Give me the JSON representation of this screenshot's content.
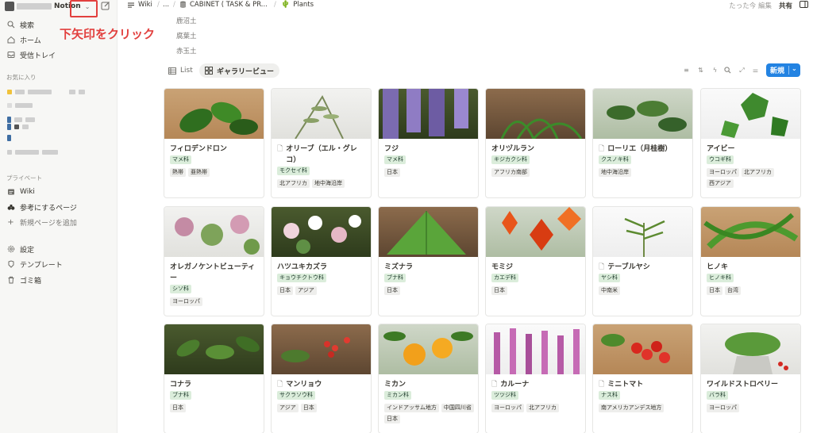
{
  "workspace": {
    "name": "Notion"
  },
  "annotation": "下矢印をクリック",
  "sidebar": {
    "nav": [
      {
        "label": "検索"
      },
      {
        "label": "ホーム"
      },
      {
        "label": "受信トレイ"
      }
    ],
    "favorites_label": "お気に入り",
    "private_label": "プライベート",
    "private_items": [
      {
        "label": "Wiki"
      },
      {
        "label": "参考にするページ"
      },
      {
        "label": "新規ページを追加"
      }
    ],
    "bottom_items": [
      {
        "label": "設定"
      },
      {
        "label": "テンプレート"
      },
      {
        "label": "ゴミ箱"
      }
    ]
  },
  "breadcrumbs": [
    {
      "label": "Wiki"
    },
    {
      "label": "..."
    },
    {
      "label": "CABINET ( TASK & PR..."
    },
    {
      "label": "Plants"
    }
  ],
  "topbar": {
    "edited": "たった今 編集",
    "share": "共有"
  },
  "soil_items": [
    "鹿沼土",
    "腐葉土",
    "赤玉土"
  ],
  "views": [
    {
      "label": "List"
    },
    {
      "label": "ギャラリービュー"
    }
  ],
  "new_button": "新規",
  "cards": [
    {
      "title": "フィロデンドロン",
      "doc": false,
      "tags": [
        [
          "マメ科",
          "fam"
        ]
      ],
      "tags2": [
        [
          "熱帯",
          "reg"
        ],
        [
          "亜熱帯",
          "reg"
        ]
      ]
    },
    {
      "title": "オリーブ（エル・グレコ）",
      "doc": true,
      "tags": [
        [
          "モクセイ科",
          "fam"
        ]
      ],
      "tags2": [
        [
          "北アフリカ",
          "reg"
        ],
        [
          "地中海沿岸",
          "reg"
        ]
      ]
    },
    {
      "title": "フジ",
      "doc": false,
      "tags": [
        [
          "マメ科",
          "fam"
        ]
      ],
      "tags2": [
        [
          "日本",
          "reg"
        ]
      ]
    },
    {
      "title": "オリヅルラン",
      "doc": false,
      "tags": [
        [
          "キジカクシ科",
          "fam"
        ]
      ],
      "tags2": [
        [
          "アフリカ南部",
          "reg"
        ]
      ]
    },
    {
      "title": "ローリエ（月桂樹）",
      "doc": true,
      "tags": [
        [
          "クスノキ科",
          "fam"
        ]
      ],
      "tags2": [
        [
          "地中海沿岸",
          "reg"
        ]
      ]
    },
    {
      "title": "アイビー",
      "doc": false,
      "tags": [
        [
          "ウコギ科",
          "fam"
        ]
      ],
      "tags2": [
        [
          "ヨーロッパ",
          "reg"
        ],
        [
          "北アフリカ",
          "reg"
        ],
        [
          "西アジア",
          "reg"
        ]
      ]
    },
    {
      "title": "オレガノケントビューティー",
      "doc": false,
      "tags": [
        [
          "シソ科",
          "fam"
        ]
      ],
      "tags2": [
        [
          "ヨーロッパ",
          "reg"
        ]
      ]
    },
    {
      "title": "ハツユキカズラ",
      "doc": false,
      "tags": [
        [
          "キョウチクトウ科",
          "fam"
        ]
      ],
      "tags2": [
        [
          "日本",
          "reg"
        ],
        [
          "アジア",
          "reg"
        ]
      ]
    },
    {
      "title": "ミズナラ",
      "doc": false,
      "tags": [
        [
          "ブナ科",
          "fam"
        ]
      ],
      "tags2": [
        [
          "日本",
          "reg"
        ]
      ]
    },
    {
      "title": "モミジ",
      "doc": false,
      "tags": [
        [
          "カエデ科",
          "fam"
        ]
      ],
      "tags2": [
        [
          "日本",
          "reg"
        ]
      ]
    },
    {
      "title": "テーブルヤシ",
      "doc": true,
      "tags": [
        [
          "ヤシ科",
          "fam"
        ]
      ],
      "tags2": [
        [
          "中南米",
          "reg"
        ]
      ]
    },
    {
      "title": "ヒノキ",
      "doc": false,
      "tags": [
        [
          "ヒノキ科",
          "fam"
        ]
      ],
      "tags2": [
        [
          "日本",
          "reg"
        ],
        [
          "台湾",
          "reg"
        ]
      ]
    },
    {
      "title": "コナラ",
      "doc": false,
      "tags": [
        [
          "ブナ科",
          "fam"
        ]
      ],
      "tags2": [
        [
          "日本",
          "reg"
        ]
      ]
    },
    {
      "title": "マンリョウ",
      "doc": true,
      "tags": [
        [
          "サクラソウ科",
          "fam"
        ]
      ],
      "tags2": [
        [
          "アジア",
          "reg"
        ],
        [
          "日本",
          "reg"
        ]
      ]
    },
    {
      "title": "ミカン",
      "doc": false,
      "tags": [
        [
          "ミカン科",
          "fam"
        ]
      ],
      "tags2": [
        [
          "インドアッサム地方",
          "reg"
        ],
        [
          "中国四川省",
          "reg"
        ],
        [
          "日本",
          "reg"
        ]
      ]
    },
    {
      "title": "カルーナ",
      "doc": true,
      "tags": [
        [
          "ツツジ科",
          "fam"
        ]
      ],
      "tags2": [
        [
          "ヨーロッパ",
          "reg"
        ],
        [
          "北アフリカ",
          "reg"
        ]
      ]
    },
    {
      "title": "ミニトマト",
      "doc": true,
      "tags": [
        [
          "ナス科",
          "fam"
        ]
      ],
      "tags2": [
        [
          "南アメリカアンデス地方",
          "reg"
        ]
      ]
    },
    {
      "title": "ワイルドストロベリー",
      "doc": false,
      "tags": [
        [
          "バラ科",
          "fam"
        ]
      ],
      "tags2": [
        [
          "ヨーロッパ",
          "reg"
        ]
      ]
    }
  ]
}
